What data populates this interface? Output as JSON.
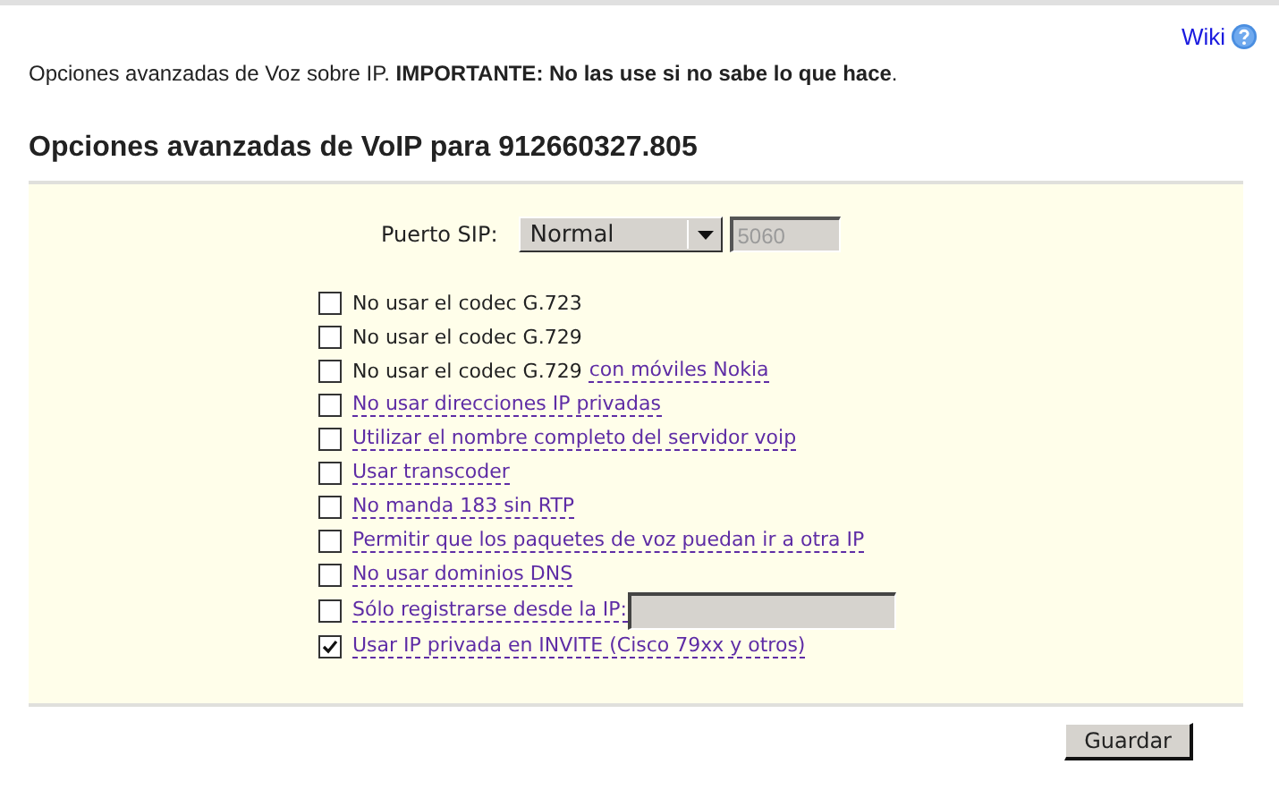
{
  "wiki_link": "Wiki",
  "intro": "Opciones avanzadas de Voz sobre IP. **IMPORTANTE: No las use si no sabe lo que hace**.",
  "heading": "Opciones avanzadas de VoIP para 912660327.805",
  "sip_port": {
    "label": "Puerto SIP:",
    "value": "Normal",
    "port_placeholder": "5060",
    "port_disabled": true
  },
  "options": [
    {
      "kind": "checkbox",
      "text": "No usar el codec G.723",
      "checked": false
    },
    {
      "kind": "checkbox",
      "text": "No usar el codec G.729",
      "checked": false
    },
    {
      "kind": "checkbox",
      "text": "No usar el codec G.729",
      "link": "con móviles Nokia",
      "checked": false
    },
    {
      "kind": "checkbox",
      "link": "No usar direcciones IP privadas",
      "checked": false
    },
    {
      "kind": "checkbox",
      "link": "Utilizar el nombre completo del servidor voip",
      "checked": false
    },
    {
      "kind": "checkbox",
      "link": "Usar transcoder",
      "checked": false
    },
    {
      "kind": "checkbox",
      "link": "No manda 183 sin RTP",
      "checked": false
    },
    {
      "kind": "checkbox",
      "link": "Permitir que los paquetes de voz puedan ir a otra IP",
      "checked": false
    },
    {
      "kind": "checkbox",
      "link": "No usar dominios DNS",
      "checked": false
    },
    {
      "kind": "checkbox-field",
      "link": "Sólo registrarse desde la IP:",
      "checked": false
    },
    {
      "kind": "checkbox",
      "link": "Usar IP privada en INVITE (Cisco 79xx y otros)",
      "checked": true
    }
  ],
  "save_button": "Guardar"
}
